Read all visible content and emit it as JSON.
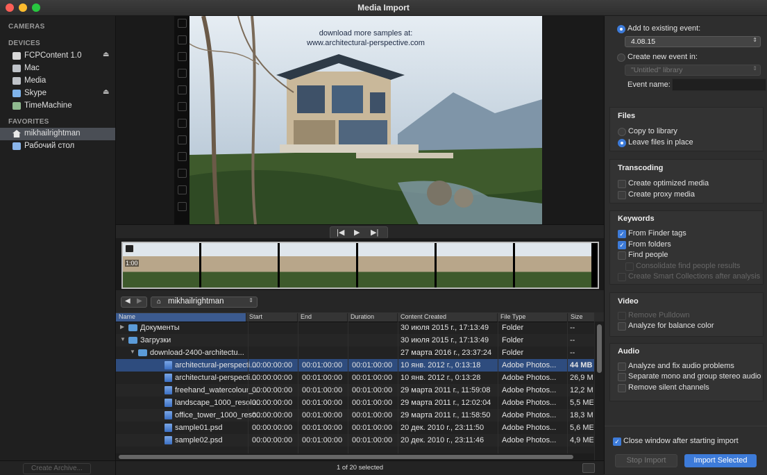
{
  "window": {
    "title": "Media Import"
  },
  "sidebar": {
    "cameras_header": "CAMERAS",
    "devices_header": "DEVICES",
    "devices": [
      {
        "label": "FCPContent 1.0",
        "icon": "drive-icon",
        "eject": "⏏"
      },
      {
        "label": "Mac",
        "icon": "harddisk-icon"
      },
      {
        "label": "Media",
        "icon": "harddisk-icon"
      },
      {
        "label": "Skype",
        "icon": "disk-image-icon",
        "eject": "⏏"
      },
      {
        "label": "TimeMachine",
        "icon": "timemachine-disk-icon"
      }
    ],
    "favorites_header": "FAVORITES",
    "favorites": [
      {
        "label": "mikhailrightman",
        "icon": "home-icon",
        "selected": true
      },
      {
        "label": "Рабочий стол",
        "icon": "desktop-folder-icon"
      }
    ],
    "archive_button": "Create Archive..."
  },
  "viewer": {
    "caption_line1": "download more samples at:",
    "caption_line2": "www.architectural-perspective.com",
    "thumb_duration": "1:00"
  },
  "pathbar": {
    "location": "mikhailrightman"
  },
  "table": {
    "columns": [
      "Name",
      "Start",
      "End",
      "Duration",
      "Content Created",
      "File Type",
      "Size"
    ],
    "rows": [
      {
        "name": "Документы",
        "start": "",
        "end": "",
        "duration": "",
        "created": "30 июля 2015 г., 17:13:49",
        "type": "Folder",
        "size": "--",
        "level": 0,
        "kind": "folder",
        "disclosure": "▶"
      },
      {
        "name": "Загрузки",
        "start": "",
        "end": "",
        "duration": "",
        "created": "30 июля 2015 г., 17:13:49",
        "type": "Folder",
        "size": "--",
        "level": 0,
        "kind": "folder",
        "disclosure": "▼"
      },
      {
        "name": "download-2400-architectu...",
        "start": "",
        "end": "",
        "duration": "",
        "created": "27 марта 2016 г., 23:37:24",
        "type": "Folder",
        "size": "--",
        "level": 1,
        "kind": "folder",
        "disclosure": "▼"
      },
      {
        "name": "architectural-perspecti...",
        "start": "00:00:00:00",
        "end": "00:01:00:00",
        "duration": "00:01:00:00",
        "created": "10 янв. 2012 г., 0:13:18",
        "type": "Adobe Photos...",
        "size": "44 MB",
        "level": 2,
        "kind": "file",
        "selected": true
      },
      {
        "name": "architectural-perspecti...",
        "start": "00:00:00:00",
        "end": "00:01:00:00",
        "duration": "00:01:00:00",
        "created": "10 янв. 2012 г., 0:13:28",
        "type": "Adobe Photos...",
        "size": "26,9 M",
        "level": 2,
        "kind": "file"
      },
      {
        "name": "freehand_watercolour_...",
        "start": "00:00:00:00",
        "end": "00:01:00:00",
        "duration": "00:01:00:00",
        "created": "29 марта 2011 г., 11:59:08",
        "type": "Adobe Photos...",
        "size": "12,2 M",
        "level": 2,
        "kind": "file"
      },
      {
        "name": "landscape_1000_resolu...",
        "start": "00:00:00:00",
        "end": "00:01:00:00",
        "duration": "00:01:00:00",
        "created": "29 марта 2011 г., 12:02:04",
        "type": "Adobe Photos...",
        "size": "5,5 ME",
        "level": 2,
        "kind": "file"
      },
      {
        "name": "office_tower_1000_reso...",
        "start": "00:00:00:00",
        "end": "00:01:00:00",
        "duration": "00:01:00:00",
        "created": "29 марта 2011 г., 11:58:50",
        "type": "Adobe Photos...",
        "size": "18,3 M",
        "level": 2,
        "kind": "file"
      },
      {
        "name": "sample01.psd",
        "start": "00:00:00:00",
        "end": "00:01:00:00",
        "duration": "00:01:00:00",
        "created": "20 дек. 2010 г., 23:11:50",
        "type": "Adobe Photos...",
        "size": "5,6 ME",
        "level": 2,
        "kind": "file"
      },
      {
        "name": "sample02.psd",
        "start": "00:00:00:00",
        "end": "00:01:00:00",
        "duration": "00:01:00:00",
        "created": "20 дек. 2010 г., 23:11:46",
        "type": "Adobe Photos...",
        "size": "4,9 ME",
        "level": 2,
        "kind": "file"
      }
    ],
    "status": "1 of 20 selected"
  },
  "import_options": {
    "add_existing_label": "Add to existing event:",
    "existing_event_value": "4.08.15",
    "create_new_label": "Create new event in:",
    "library_value": "\"Untitled\" library",
    "event_name_label": "Event name:",
    "files_title": "Files",
    "copy_label": "Copy to library",
    "leave_label": "Leave files in place",
    "transcoding_title": "Transcoding",
    "optimized_label": "Create optimized media",
    "proxy_label": "Create proxy media",
    "keywords_title": "Keywords",
    "finder_tags_label": "From Finder tags",
    "folders_label": "From folders",
    "find_people_label": "Find people",
    "consolidate_label": "Consolidate find people results",
    "smart_collections_label": "Create Smart Collections after analysis",
    "video_title": "Video",
    "pulldown_label": "Remove Pulldown",
    "balance_label": "Analyze for balance color",
    "audio_title": "Audio",
    "fix_audio_label": "Analyze and fix audio problems",
    "separate_mono_label": "Separate mono and group stereo audio",
    "silent_label": "Remove silent channels",
    "close_window_label": "Close window after starting import",
    "stop_button": "Stop Import",
    "import_button": "Import Selected",
    "accent_color": "#3d7bd9"
  }
}
